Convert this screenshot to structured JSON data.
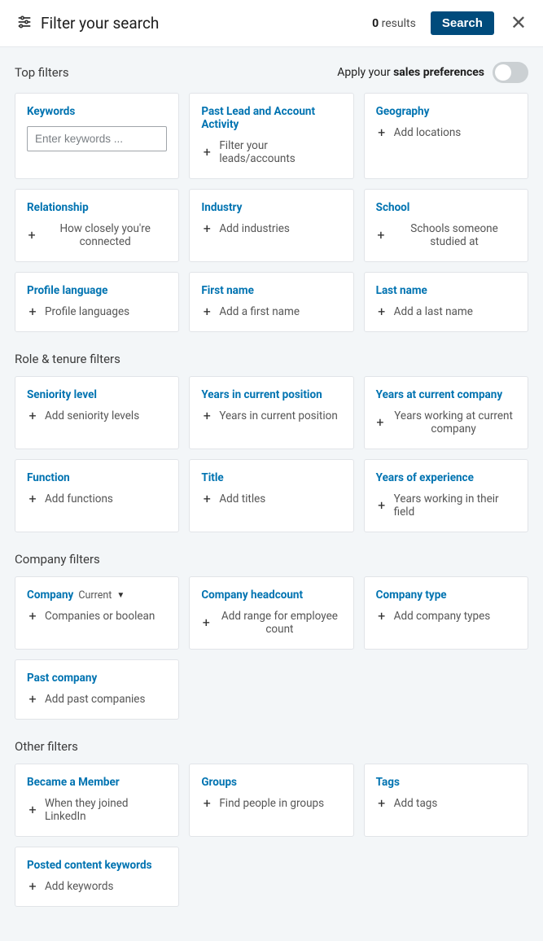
{
  "header": {
    "title": "Filter your search",
    "results_count": "0",
    "results_label": "results",
    "search_label": "Search"
  },
  "preferences": {
    "prefix": "Apply your",
    "bold": "sales preferences"
  },
  "sections": {
    "top": {
      "title": "Top filters",
      "cards": {
        "keywords": {
          "title": "Keywords",
          "placeholder": "Enter keywords ..."
        },
        "past_lead": {
          "title": "Past Lead and Account Activity",
          "hint": "Filter your leads/accounts"
        },
        "geography": {
          "title": "Geography",
          "hint": "Add locations"
        },
        "relationship": {
          "title": "Relationship",
          "hint": "How closely you're connected"
        },
        "industry": {
          "title": "Industry",
          "hint": "Add industries"
        },
        "school": {
          "title": "School",
          "hint": "Schools someone studied at"
        },
        "profile_language": {
          "title": "Profile language",
          "hint": "Profile languages"
        },
        "first_name": {
          "title": "First name",
          "hint": "Add a first name"
        },
        "last_name": {
          "title": "Last name",
          "hint": "Add a last name"
        }
      }
    },
    "role": {
      "title": "Role & tenure filters",
      "cards": {
        "seniority": {
          "title": "Seniority level",
          "hint": "Add seniority levels"
        },
        "years_position": {
          "title": "Years in current position",
          "hint": "Years in current position"
        },
        "years_company": {
          "title": "Years at current company",
          "hint": "Years working at current company"
        },
        "function": {
          "title": "Function",
          "hint": "Add functions"
        },
        "title_f": {
          "title": "Title",
          "hint": "Add titles"
        },
        "years_exp": {
          "title": "Years of experience",
          "hint": "Years working in their field"
        }
      }
    },
    "company": {
      "title": "Company filters",
      "cards": {
        "company": {
          "title": "Company",
          "chip": "Current",
          "hint": "Companies or boolean"
        },
        "headcount": {
          "title": "Company headcount",
          "hint": "Add range for employee count"
        },
        "type": {
          "title": "Company type",
          "hint": "Add company types"
        },
        "past": {
          "title": "Past company",
          "hint": "Add past companies"
        }
      }
    },
    "other": {
      "title": "Other filters",
      "cards": {
        "member": {
          "title": "Became a Member",
          "hint": "When they joined LinkedIn"
        },
        "groups": {
          "title": "Groups",
          "hint": "Find people in groups"
        },
        "tags": {
          "title": "Tags",
          "hint": "Add tags"
        },
        "posted": {
          "title": "Posted content keywords",
          "hint": "Add keywords"
        }
      }
    }
  }
}
